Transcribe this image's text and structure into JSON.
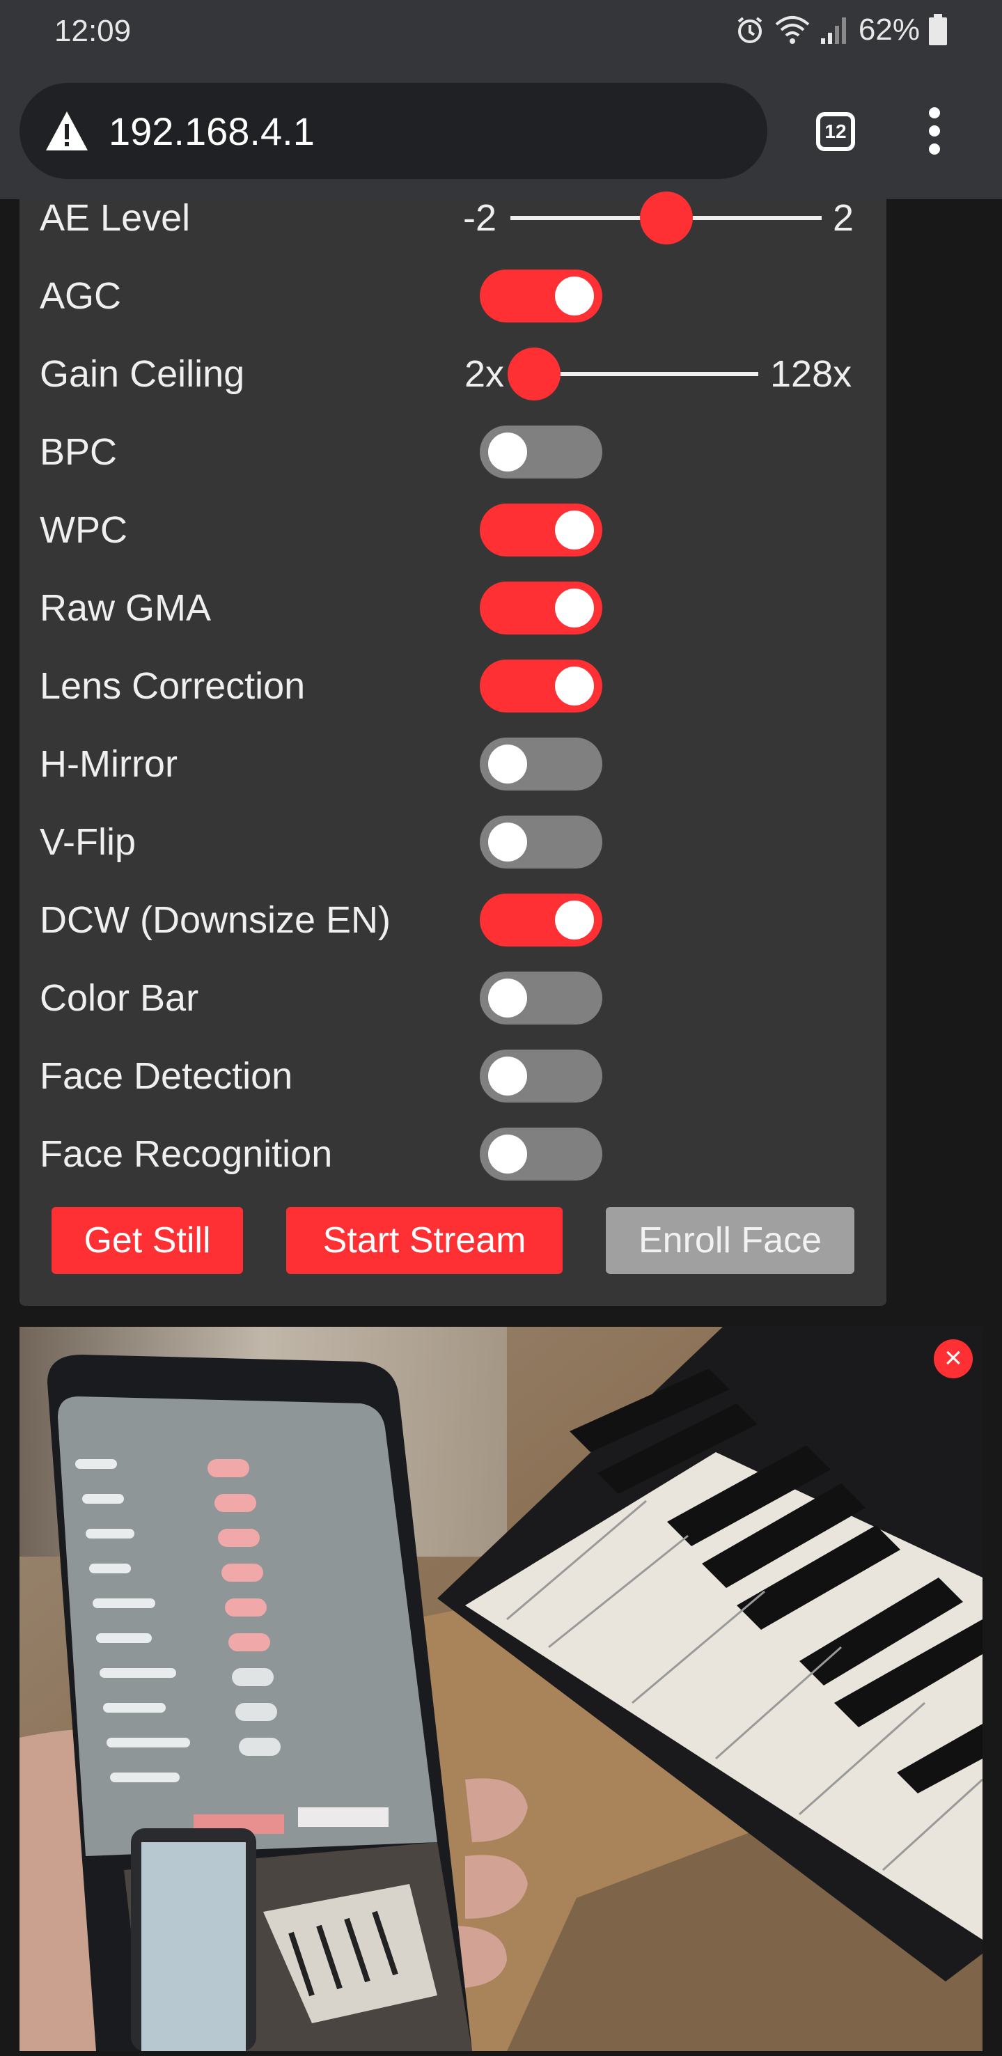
{
  "status_bar": {
    "time": "12:09",
    "battery": "62%"
  },
  "browser": {
    "url": "192.168.4.1",
    "tab_count": "12"
  },
  "settings": {
    "ae_level": {
      "label": "AE Level",
      "min": "-2",
      "max": "2",
      "value": 0
    },
    "gain_ceiling": {
      "label": "Gain Ceiling",
      "min": "2x",
      "max": "128x",
      "value_fraction": 0.06
    },
    "toggles": [
      {
        "label": "AGC",
        "on": true
      },
      {
        "label": "BPC",
        "on": false
      },
      {
        "label": "WPC",
        "on": true
      },
      {
        "label": "Raw GMA",
        "on": true
      },
      {
        "label": "Lens Correction",
        "on": true
      },
      {
        "label": "H-Mirror",
        "on": false
      },
      {
        "label": "V-Flip",
        "on": false
      },
      {
        "label": "DCW (Downsize EN)",
        "on": true
      },
      {
        "label": "Color Bar",
        "on": false
      },
      {
        "label": "Face Detection",
        "on": false
      },
      {
        "label": "Face Recognition",
        "on": false
      }
    ]
  },
  "buttons": {
    "get_still": "Get Still",
    "start_stream": "Start Stream",
    "enroll_face": "Enroll Face"
  },
  "stream": {
    "close_glyph": "×"
  },
  "colors": {
    "accent": "#ff3034",
    "toggle_off": "#808080",
    "panel": "#363636"
  }
}
